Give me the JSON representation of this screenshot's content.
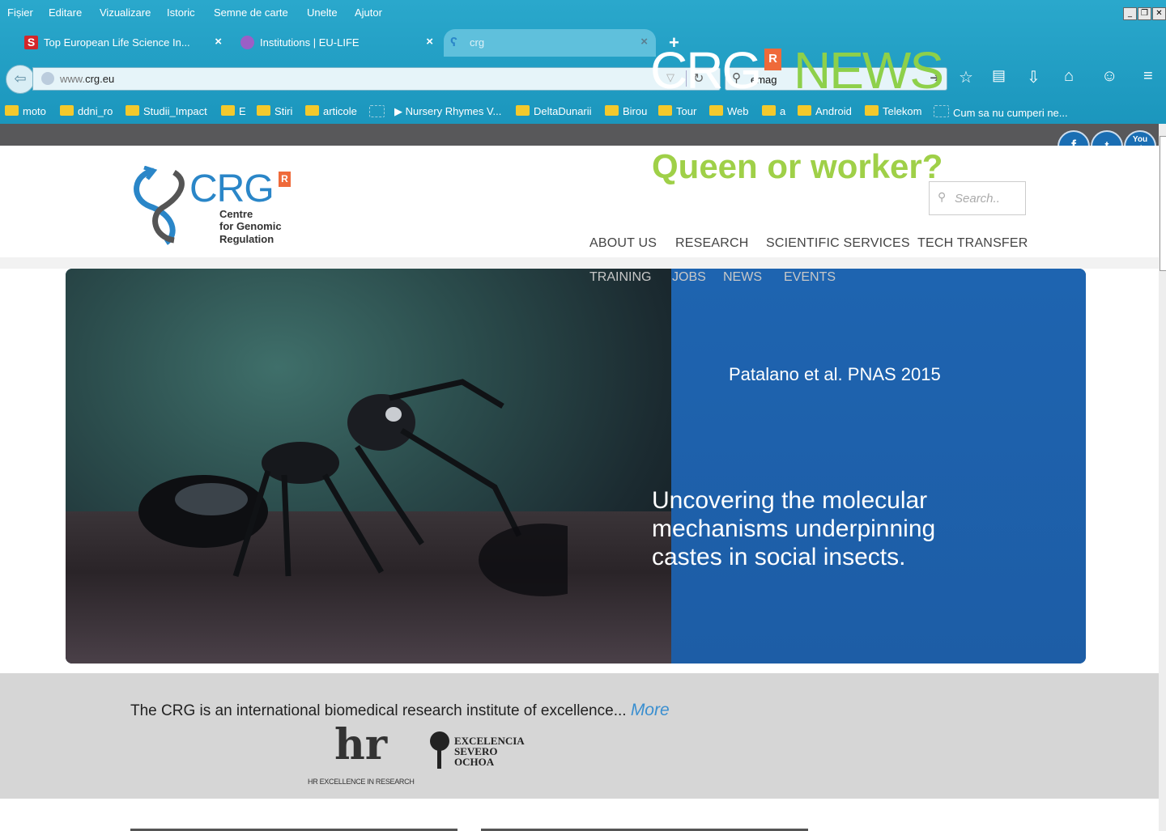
{
  "menubar": {
    "items": [
      "Fișier",
      "Editare",
      "Vizualizare",
      "Istoric",
      "Semne de carte",
      "Unelte",
      "Ajutor"
    ]
  },
  "tabs": [
    {
      "label": "Top European Life Science In...",
      "close": "×"
    },
    {
      "label": "Institutions | EU-LIFE",
      "close": "×"
    },
    {
      "label": "crg",
      "close": "×"
    }
  ],
  "new_tab": "+",
  "navbar": {
    "url_prefix": "www.",
    "url_domain": "crg.eu",
    "search_value": "emag"
  },
  "bookmarks": [
    {
      "label": "moto",
      "type": "folder"
    },
    {
      "label": "ddni_ro",
      "type": "folder"
    },
    {
      "label": "Studii_Impact",
      "type": "folder"
    },
    {
      "label": "E",
      "type": "folder"
    },
    {
      "label": "Stiri",
      "type": "folder"
    },
    {
      "label": "articole",
      "type": "folder"
    },
    {
      "label": "",
      "type": "page"
    },
    {
      "label": "▶ Nursery Rhymes V...",
      "type": "link"
    },
    {
      "label": "DeltaDunarii",
      "type": "folder"
    },
    {
      "label": "Birou",
      "type": "folder"
    },
    {
      "label": "Tour",
      "type": "folder"
    },
    {
      "label": "Web",
      "type": "folder"
    },
    {
      "label": "a",
      "type": "folder"
    },
    {
      "label": "Android",
      "type": "folder"
    },
    {
      "label": "Telekom",
      "type": "folder"
    },
    {
      "label": "Cum sa nu cumperi ne...",
      "type": "page"
    }
  ],
  "social": [
    "f",
    "t",
    "You Tube"
  ],
  "site": {
    "logo_text": "CRG",
    "logo_badge": "R",
    "logo_sub": [
      "Centre",
      "for Genomic",
      "Regulation"
    ],
    "search_placeholder": "Search..",
    "nav": [
      "ABOUT US",
      "RESEARCH",
      "SCIENTIFIC SERVICES",
      "TECH TRANSFER"
    ],
    "nav_second_row": [
      "TRAINING",
      "JOBS",
      "NEWS",
      "EVENTS"
    ]
  },
  "banner": {
    "brand": "CRG",
    "badge": "R",
    "news_word": "NEWS",
    "headline": "Queen or worker?",
    "subtitle_lines": [
      "Uncovering the molecular",
      "mechanisms underpinning",
      "castes in social insects."
    ],
    "citation": "Patalano et al. PNAS 2015"
  },
  "about": {
    "text": "The CRG is an international biomedical research institute of excellence...",
    "more": "More",
    "hr_logo": "hr",
    "hr_caption": "HR EXCELLENCE IN RESEARCH",
    "excelencia_lines": [
      "EXCELENCIA",
      "SEVERO",
      "OCHOA"
    ]
  },
  "colors": {
    "chrome": "#1f9ec4",
    "crg_blue": "#2a86c8",
    "news_green": "#8ed04a",
    "banner_blue": "#1e64b0",
    "badge_orange": "#ef6a3a"
  }
}
